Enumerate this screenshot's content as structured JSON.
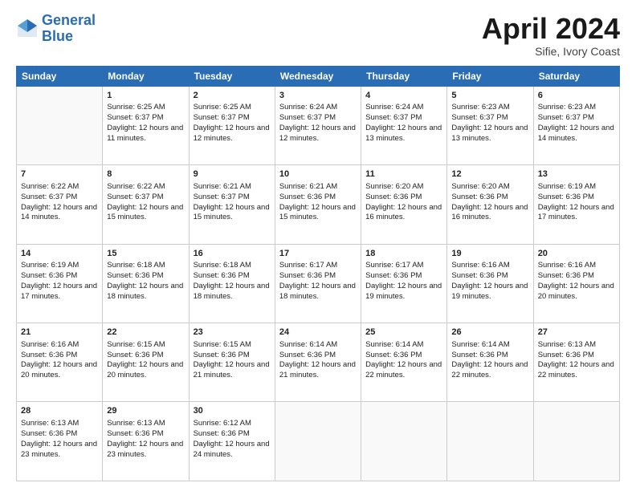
{
  "header": {
    "logo_line1": "General",
    "logo_line2": "Blue",
    "title": "April 2024",
    "subtitle": "Sifie, Ivory Coast"
  },
  "calendar": {
    "days_of_week": [
      "Sunday",
      "Monday",
      "Tuesday",
      "Wednesday",
      "Thursday",
      "Friday",
      "Saturday"
    ],
    "weeks": [
      [
        {
          "day": "",
          "sunrise": "",
          "sunset": "",
          "daylight": ""
        },
        {
          "day": "1",
          "sunrise": "Sunrise: 6:25 AM",
          "sunset": "Sunset: 6:37 PM",
          "daylight": "Daylight: 12 hours and 11 minutes."
        },
        {
          "day": "2",
          "sunrise": "Sunrise: 6:25 AM",
          "sunset": "Sunset: 6:37 PM",
          "daylight": "Daylight: 12 hours and 12 minutes."
        },
        {
          "day": "3",
          "sunrise": "Sunrise: 6:24 AM",
          "sunset": "Sunset: 6:37 PM",
          "daylight": "Daylight: 12 hours and 12 minutes."
        },
        {
          "day": "4",
          "sunrise": "Sunrise: 6:24 AM",
          "sunset": "Sunset: 6:37 PM",
          "daylight": "Daylight: 12 hours and 13 minutes."
        },
        {
          "day": "5",
          "sunrise": "Sunrise: 6:23 AM",
          "sunset": "Sunset: 6:37 PM",
          "daylight": "Daylight: 12 hours and 13 minutes."
        },
        {
          "day": "6",
          "sunrise": "Sunrise: 6:23 AM",
          "sunset": "Sunset: 6:37 PM",
          "daylight": "Daylight: 12 hours and 14 minutes."
        }
      ],
      [
        {
          "day": "7",
          "sunrise": "Sunrise: 6:22 AM",
          "sunset": "Sunset: 6:37 PM",
          "daylight": "Daylight: 12 hours and 14 minutes."
        },
        {
          "day": "8",
          "sunrise": "Sunrise: 6:22 AM",
          "sunset": "Sunset: 6:37 PM",
          "daylight": "Daylight: 12 hours and 15 minutes."
        },
        {
          "day": "9",
          "sunrise": "Sunrise: 6:21 AM",
          "sunset": "Sunset: 6:37 PM",
          "daylight": "Daylight: 12 hours and 15 minutes."
        },
        {
          "day": "10",
          "sunrise": "Sunrise: 6:21 AM",
          "sunset": "Sunset: 6:36 PM",
          "daylight": "Daylight: 12 hours and 15 minutes."
        },
        {
          "day": "11",
          "sunrise": "Sunrise: 6:20 AM",
          "sunset": "Sunset: 6:36 PM",
          "daylight": "Daylight: 12 hours and 16 minutes."
        },
        {
          "day": "12",
          "sunrise": "Sunrise: 6:20 AM",
          "sunset": "Sunset: 6:36 PM",
          "daylight": "Daylight: 12 hours and 16 minutes."
        },
        {
          "day": "13",
          "sunrise": "Sunrise: 6:19 AM",
          "sunset": "Sunset: 6:36 PM",
          "daylight": "Daylight: 12 hours and 17 minutes."
        }
      ],
      [
        {
          "day": "14",
          "sunrise": "Sunrise: 6:19 AM",
          "sunset": "Sunset: 6:36 PM",
          "daylight": "Daylight: 12 hours and 17 minutes."
        },
        {
          "day": "15",
          "sunrise": "Sunrise: 6:18 AM",
          "sunset": "Sunset: 6:36 PM",
          "daylight": "Daylight: 12 hours and 18 minutes."
        },
        {
          "day": "16",
          "sunrise": "Sunrise: 6:18 AM",
          "sunset": "Sunset: 6:36 PM",
          "daylight": "Daylight: 12 hours and 18 minutes."
        },
        {
          "day": "17",
          "sunrise": "Sunrise: 6:17 AM",
          "sunset": "Sunset: 6:36 PM",
          "daylight": "Daylight: 12 hours and 18 minutes."
        },
        {
          "day": "18",
          "sunrise": "Sunrise: 6:17 AM",
          "sunset": "Sunset: 6:36 PM",
          "daylight": "Daylight: 12 hours and 19 minutes."
        },
        {
          "day": "19",
          "sunrise": "Sunrise: 6:16 AM",
          "sunset": "Sunset: 6:36 PM",
          "daylight": "Daylight: 12 hours and 19 minutes."
        },
        {
          "day": "20",
          "sunrise": "Sunrise: 6:16 AM",
          "sunset": "Sunset: 6:36 PM",
          "daylight": "Daylight: 12 hours and 20 minutes."
        }
      ],
      [
        {
          "day": "21",
          "sunrise": "Sunrise: 6:16 AM",
          "sunset": "Sunset: 6:36 PM",
          "daylight": "Daylight: 12 hours and 20 minutes."
        },
        {
          "day": "22",
          "sunrise": "Sunrise: 6:15 AM",
          "sunset": "Sunset: 6:36 PM",
          "daylight": "Daylight: 12 hours and 20 minutes."
        },
        {
          "day": "23",
          "sunrise": "Sunrise: 6:15 AM",
          "sunset": "Sunset: 6:36 PM",
          "daylight": "Daylight: 12 hours and 21 minutes."
        },
        {
          "day": "24",
          "sunrise": "Sunrise: 6:14 AM",
          "sunset": "Sunset: 6:36 PM",
          "daylight": "Daylight: 12 hours and 21 minutes."
        },
        {
          "day": "25",
          "sunrise": "Sunrise: 6:14 AM",
          "sunset": "Sunset: 6:36 PM",
          "daylight": "Daylight: 12 hours and 22 minutes."
        },
        {
          "day": "26",
          "sunrise": "Sunrise: 6:14 AM",
          "sunset": "Sunset: 6:36 PM",
          "daylight": "Daylight: 12 hours and 22 minutes."
        },
        {
          "day": "27",
          "sunrise": "Sunrise: 6:13 AM",
          "sunset": "Sunset: 6:36 PM",
          "daylight": "Daylight: 12 hours and 22 minutes."
        }
      ],
      [
        {
          "day": "28",
          "sunrise": "Sunrise: 6:13 AM",
          "sunset": "Sunset: 6:36 PM",
          "daylight": "Daylight: 12 hours and 23 minutes."
        },
        {
          "day": "29",
          "sunrise": "Sunrise: 6:13 AM",
          "sunset": "Sunset: 6:36 PM",
          "daylight": "Daylight: 12 hours and 23 minutes."
        },
        {
          "day": "30",
          "sunrise": "Sunrise: 6:12 AM",
          "sunset": "Sunset: 6:36 PM",
          "daylight": "Daylight: 12 hours and 24 minutes."
        },
        {
          "day": "",
          "sunrise": "",
          "sunset": "",
          "daylight": ""
        },
        {
          "day": "",
          "sunrise": "",
          "sunset": "",
          "daylight": ""
        },
        {
          "day": "",
          "sunrise": "",
          "sunset": "",
          "daylight": ""
        },
        {
          "day": "",
          "sunrise": "",
          "sunset": "",
          "daylight": ""
        }
      ]
    ]
  }
}
